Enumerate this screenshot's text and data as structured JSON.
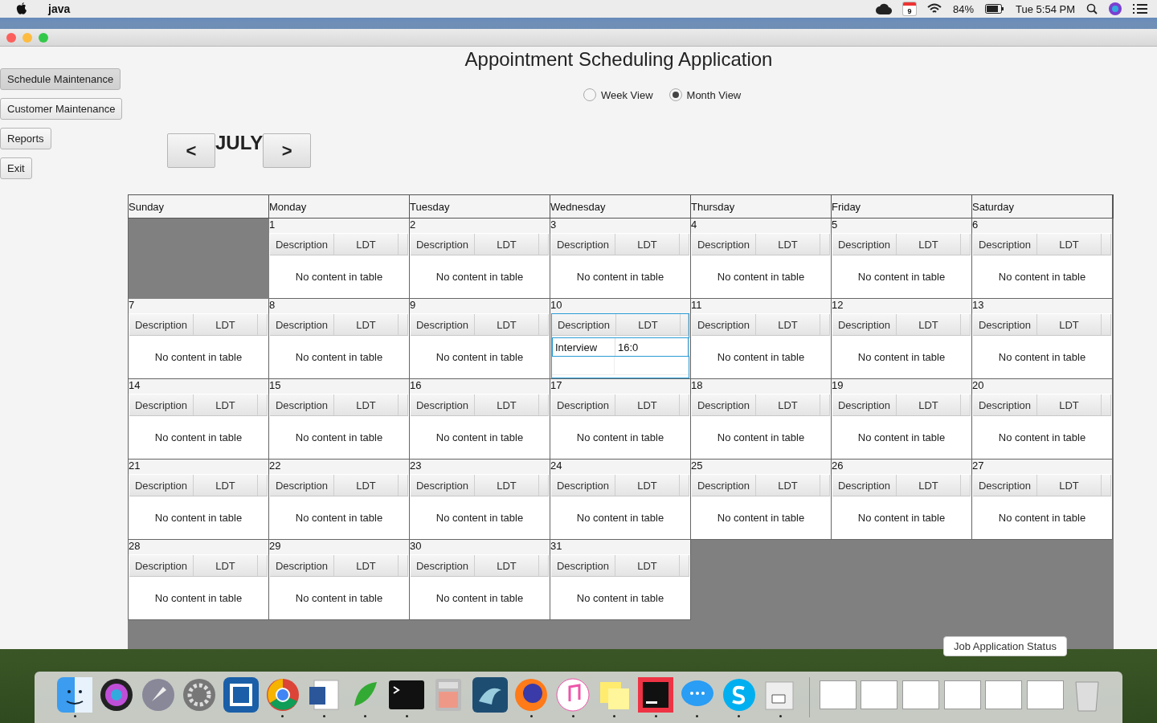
{
  "menubar": {
    "app_name": "java",
    "battery": "84%",
    "calendar_day": "9",
    "clock": "Tue 5:54 PM"
  },
  "window": {
    "title": "Appointment Scheduling Application"
  },
  "nav_buttons": [
    {
      "label": "Schedule Maintenance",
      "selected": true
    },
    {
      "label": "Customer Maintenance",
      "selected": false
    },
    {
      "label": "Reports",
      "selected": false
    },
    {
      "label": "Exit",
      "selected": false
    }
  ],
  "views": [
    {
      "label": "Week View",
      "selected": false
    },
    {
      "label": "Month View",
      "selected": true
    }
  ],
  "month_nav": {
    "prev": "<",
    "month": "JULY",
    "next": ">"
  },
  "calendar": {
    "weekdays": [
      "Sunday",
      "Monday",
      "Tuesday",
      "Wednesday",
      "Thursday",
      "Friday",
      "Saturday"
    ],
    "weeks": [
      [
        {
          "kind": "blank"
        },
        {
          "kind": "day",
          "day": "1",
          "columns": [
            "Description",
            "LDT"
          ],
          "empty_text": "No content in table",
          "selected": false
        },
        {
          "kind": "day",
          "day": "2",
          "columns": [
            "Description",
            "LDT"
          ],
          "empty_text": "No content in table",
          "selected": false
        },
        {
          "kind": "day",
          "day": "3",
          "columns": [
            "Description",
            "LDT"
          ],
          "empty_text": "No content in table",
          "selected": false
        },
        {
          "kind": "day",
          "day": "4",
          "columns": [
            "Description",
            "LDT"
          ],
          "empty_text": "No content in table",
          "selected": false
        },
        {
          "kind": "day",
          "day": "5",
          "columns": [
            "Description",
            "LDT"
          ],
          "empty_text": "No content in table",
          "selected": false
        },
        {
          "kind": "day",
          "day": "6",
          "columns": [
            "Description",
            "LDT"
          ],
          "empty_text": "No content in table",
          "selected": false
        }
      ],
      [
        {
          "kind": "day",
          "day": "7",
          "columns": [
            "Description",
            "LDT"
          ],
          "empty_text": "No content in table",
          "selected": false
        },
        {
          "kind": "day",
          "day": "8",
          "columns": [
            "Description",
            "LDT"
          ],
          "empty_text": "No content in table",
          "selected": false
        },
        {
          "kind": "day",
          "day": "9",
          "columns": [
            "Description",
            "LDT"
          ],
          "empty_text": "No content in table",
          "selected": false
        },
        {
          "kind": "day",
          "day": "10",
          "columns": [
            "Description",
            "LDT"
          ],
          "appointments": [
            {
              "description": "Interview",
              "ldt": "16:0"
            }
          ],
          "selected": true
        },
        {
          "kind": "day",
          "day": "11",
          "columns": [
            "Description",
            "LDT"
          ],
          "empty_text": "No content in table",
          "selected": false
        },
        {
          "kind": "day",
          "day": "12",
          "columns": [
            "Description",
            "LDT"
          ],
          "empty_text": "No content in table",
          "selected": false
        },
        {
          "kind": "day",
          "day": "13",
          "columns": [
            "Description",
            "LDT"
          ],
          "empty_text": "No content in table",
          "selected": false
        }
      ],
      [
        {
          "kind": "day",
          "day": "14",
          "columns": [
            "Description",
            "LDT"
          ],
          "empty_text": "No content in table",
          "selected": false
        },
        {
          "kind": "day",
          "day": "15",
          "columns": [
            "Description",
            "LDT"
          ],
          "empty_text": "No content in table",
          "selected": false
        },
        {
          "kind": "day",
          "day": "16",
          "columns": [
            "Description",
            "LDT"
          ],
          "empty_text": "No content in table",
          "selected": false
        },
        {
          "kind": "day",
          "day": "17",
          "columns": [
            "Description",
            "LDT"
          ],
          "empty_text": "No content in table",
          "selected": false
        },
        {
          "kind": "day",
          "day": "18",
          "columns": [
            "Description",
            "LDT"
          ],
          "empty_text": "No content in table",
          "selected": false
        },
        {
          "kind": "day",
          "day": "19",
          "columns": [
            "Description",
            "LDT"
          ],
          "empty_text": "No content in table",
          "selected": false
        },
        {
          "kind": "day",
          "day": "20",
          "columns": [
            "Description",
            "LDT"
          ],
          "empty_text": "No content in table",
          "selected": false
        }
      ],
      [
        {
          "kind": "day",
          "day": "21",
          "columns": [
            "Description",
            "LDT"
          ],
          "empty_text": "No content in table",
          "selected": false
        },
        {
          "kind": "day",
          "day": "22",
          "columns": [
            "Description",
            "LDT"
          ],
          "empty_text": "No content in table",
          "selected": false
        },
        {
          "kind": "day",
          "day": "23",
          "columns": [
            "Description",
            "LDT"
          ],
          "empty_text": "No content in table",
          "selected": false
        },
        {
          "kind": "day",
          "day": "24",
          "columns": [
            "Description",
            "LDT"
          ],
          "empty_text": "No content in table",
          "selected": false
        },
        {
          "kind": "day",
          "day": "25",
          "columns": [
            "Description",
            "LDT"
          ],
          "empty_text": "No content in table",
          "selected": false
        },
        {
          "kind": "day",
          "day": "26",
          "columns": [
            "Description",
            "LDT"
          ],
          "empty_text": "No content in table",
          "selected": false
        },
        {
          "kind": "day",
          "day": "27",
          "columns": [
            "Description",
            "LDT"
          ],
          "empty_text": "No content in table",
          "selected": false
        }
      ],
      [
        {
          "kind": "day",
          "day": "28",
          "columns": [
            "Description",
            "LDT"
          ],
          "empty_text": "No content in table",
          "selected": false
        },
        {
          "kind": "day",
          "day": "29",
          "columns": [
            "Description",
            "LDT"
          ],
          "empty_text": "No content in table",
          "selected": false
        },
        {
          "kind": "day",
          "day": "30",
          "columns": [
            "Description",
            "LDT"
          ],
          "empty_text": "No content in table",
          "selected": false
        },
        {
          "kind": "day",
          "day": "31",
          "columns": [
            "Description",
            "LDT"
          ],
          "empty_text": "No content in table",
          "selected": false
        },
        {
          "kind": "blank"
        },
        {
          "kind": "blank"
        },
        {
          "kind": "blank"
        }
      ]
    ]
  },
  "dock": {
    "tooltip": "Job Application Status",
    "apps": [
      {
        "running": true
      },
      {
        "running": false
      },
      {
        "running": false
      },
      {
        "running": false
      },
      {
        "running": false
      },
      {
        "running": true
      },
      {
        "running": true
      },
      {
        "running": true
      },
      {
        "running": true
      },
      {
        "running": false
      },
      {
        "running": false
      },
      {
        "running": true
      },
      {
        "running": true
      },
      {
        "running": true
      },
      {
        "running": true
      },
      {
        "running": true
      },
      {
        "running": true
      },
      {
        "running": true
      }
    ]
  }
}
